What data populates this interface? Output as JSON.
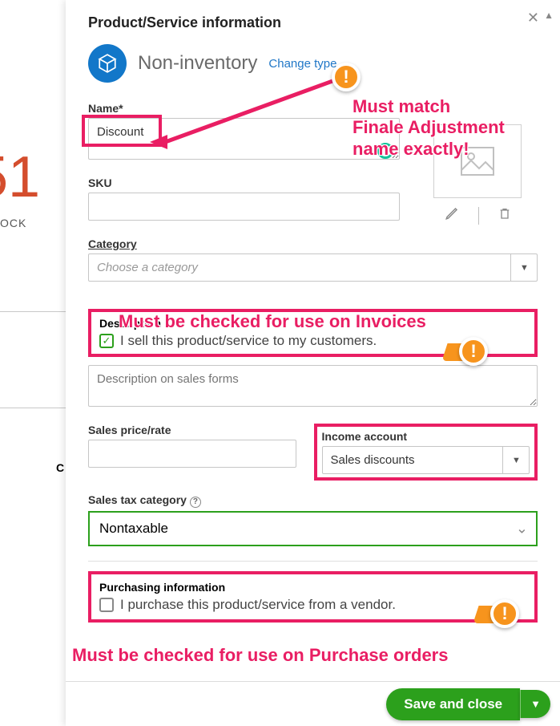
{
  "page_title": "Product/Service information",
  "type": {
    "label": "Non-inventory",
    "change_link": "Change type"
  },
  "fields": {
    "name_label": "Name",
    "name_value": "Discount",
    "sku_label": "SKU",
    "sku_value": "",
    "category_label": "Category",
    "category_placeholder": "Choose a category",
    "description_heading": "Description",
    "sell_checkbox_label": "I sell this product/service to my customers.",
    "sell_checked": true,
    "sales_desc_placeholder": "Description on sales forms",
    "sales_price_label": "Sales price/rate",
    "sales_price_value": "",
    "income_account_label": "Income account",
    "income_account_value": "Sales discounts",
    "sales_tax_label": "Sales tax category",
    "sales_tax_value": "Nontaxable",
    "purchasing_heading": "Purchasing information",
    "purchase_checkbox_label": "I purchase this product/service from a vendor.",
    "purchase_checked": false
  },
  "annotations": {
    "name_match": "Must match\nFinale Adjustment\nname exactly!",
    "invoices": "Must be checked for use on Invoices",
    "purchase_orders": "Must be checked for use on Purchase orders"
  },
  "background": {
    "number_fragment": "51",
    "stock_fragment": "OCK",
    "c_fragment": "C"
  },
  "footer": {
    "save_label": "Save and close"
  },
  "colors": {
    "accent_green": "#2ca01c",
    "annotation_pink": "#e91e63",
    "badge_orange": "#f7941d",
    "link_blue": "#2077c7",
    "type_icon_blue": "#1277c9"
  }
}
